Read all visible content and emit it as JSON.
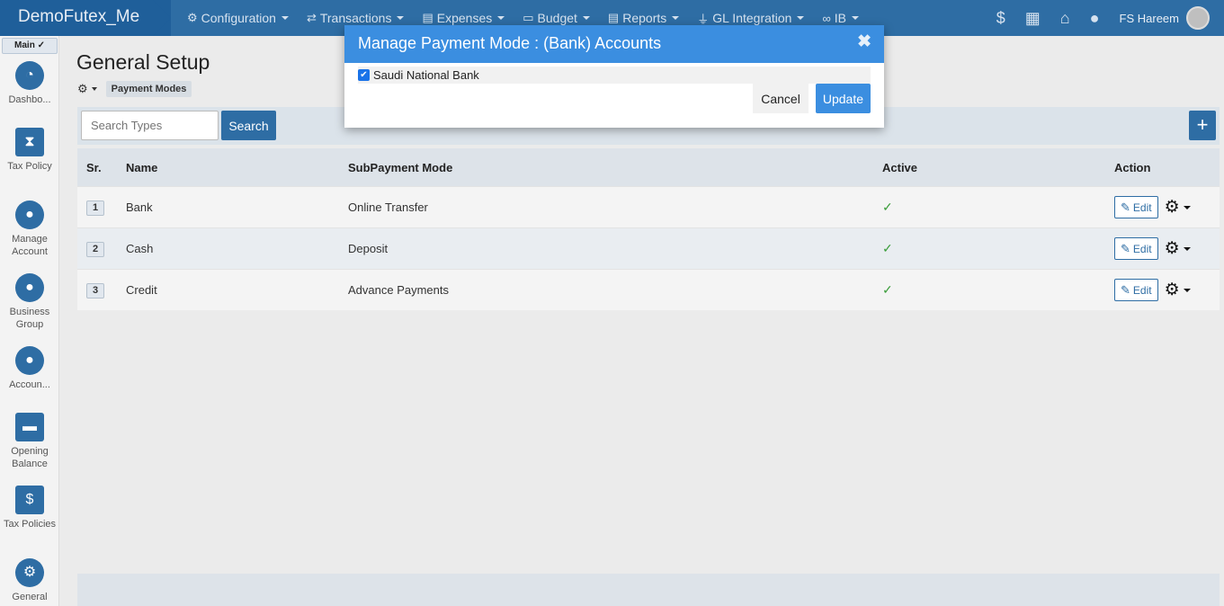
{
  "app": {
    "brand": "DemoFutex_Me"
  },
  "nav": {
    "items": [
      {
        "label": "Configuration",
        "icon": "cogs-icon",
        "glyph": "⚙"
      },
      {
        "label": "Transactions",
        "icon": "exchange-icon",
        "glyph": "⇄"
      },
      {
        "label": "Expenses",
        "icon": "document-icon",
        "glyph": "▤"
      },
      {
        "label": "Budget",
        "icon": "wallet-icon",
        "glyph": "▭"
      },
      {
        "label": "Reports",
        "icon": "file-icon",
        "glyph": "▤"
      },
      {
        "label": "GL Integration",
        "icon": "plug-icon",
        "glyph": "⏚"
      },
      {
        "label": "IB",
        "icon": "link-icon",
        "glyph": "∞"
      }
    ],
    "user_name": "FS Hareem"
  },
  "sidebar": {
    "main_tab": "Main ✓",
    "items": [
      {
        "label": "Dashbo...",
        "icon": "dashboard-icon",
        "glyph": "◔"
      },
      {
        "label": "Tax Policy",
        "icon": "hourglass-icon",
        "glyph": "⧗"
      },
      {
        "label": "Manage Account",
        "icon": "user-icon",
        "glyph": "●"
      },
      {
        "label": "Business Group",
        "icon": "user-icon",
        "glyph": "●"
      },
      {
        "label": "Accoun...",
        "icon": "user-icon",
        "glyph": "●"
      },
      {
        "label": "Opening Balance",
        "icon": "wallet-icon",
        "glyph": "▬"
      },
      {
        "label": "Tax Policies",
        "icon": "invoice-icon",
        "glyph": "$"
      },
      {
        "label": "General",
        "icon": "cogs-icon",
        "glyph": "⚙"
      }
    ]
  },
  "page": {
    "title": "General Setup",
    "breadcrumb_tag": "Payment Modes",
    "search_placeholder": "Search Types",
    "search_label": "Search",
    "add_label": "+"
  },
  "table": {
    "headers": {
      "sr": "Sr.",
      "name": "Name",
      "sub": "SubPayment Mode",
      "active": "Active",
      "action": "Action"
    },
    "rows": [
      {
        "sr": "1",
        "name": "Bank",
        "sub": "Online Transfer",
        "active": "✓",
        "edit": "Edit"
      },
      {
        "sr": "2",
        "name": "Cash",
        "sub": "Deposit",
        "active": "✓",
        "edit": "Edit"
      },
      {
        "sr": "3",
        "name": "Credit",
        "sub": "Advance Payments",
        "active": "✓",
        "edit": "Edit"
      }
    ]
  },
  "modal": {
    "title": "Manage Payment Mode : (Bank) Accounts",
    "close": "✖",
    "account_label": "Saudi National Bank",
    "account_checked": true,
    "cancel": "Cancel",
    "update": "Update"
  },
  "colors": {
    "primary": "#2e6da4",
    "modal_header": "#3b8ee0",
    "check": "#3a9d3a"
  }
}
